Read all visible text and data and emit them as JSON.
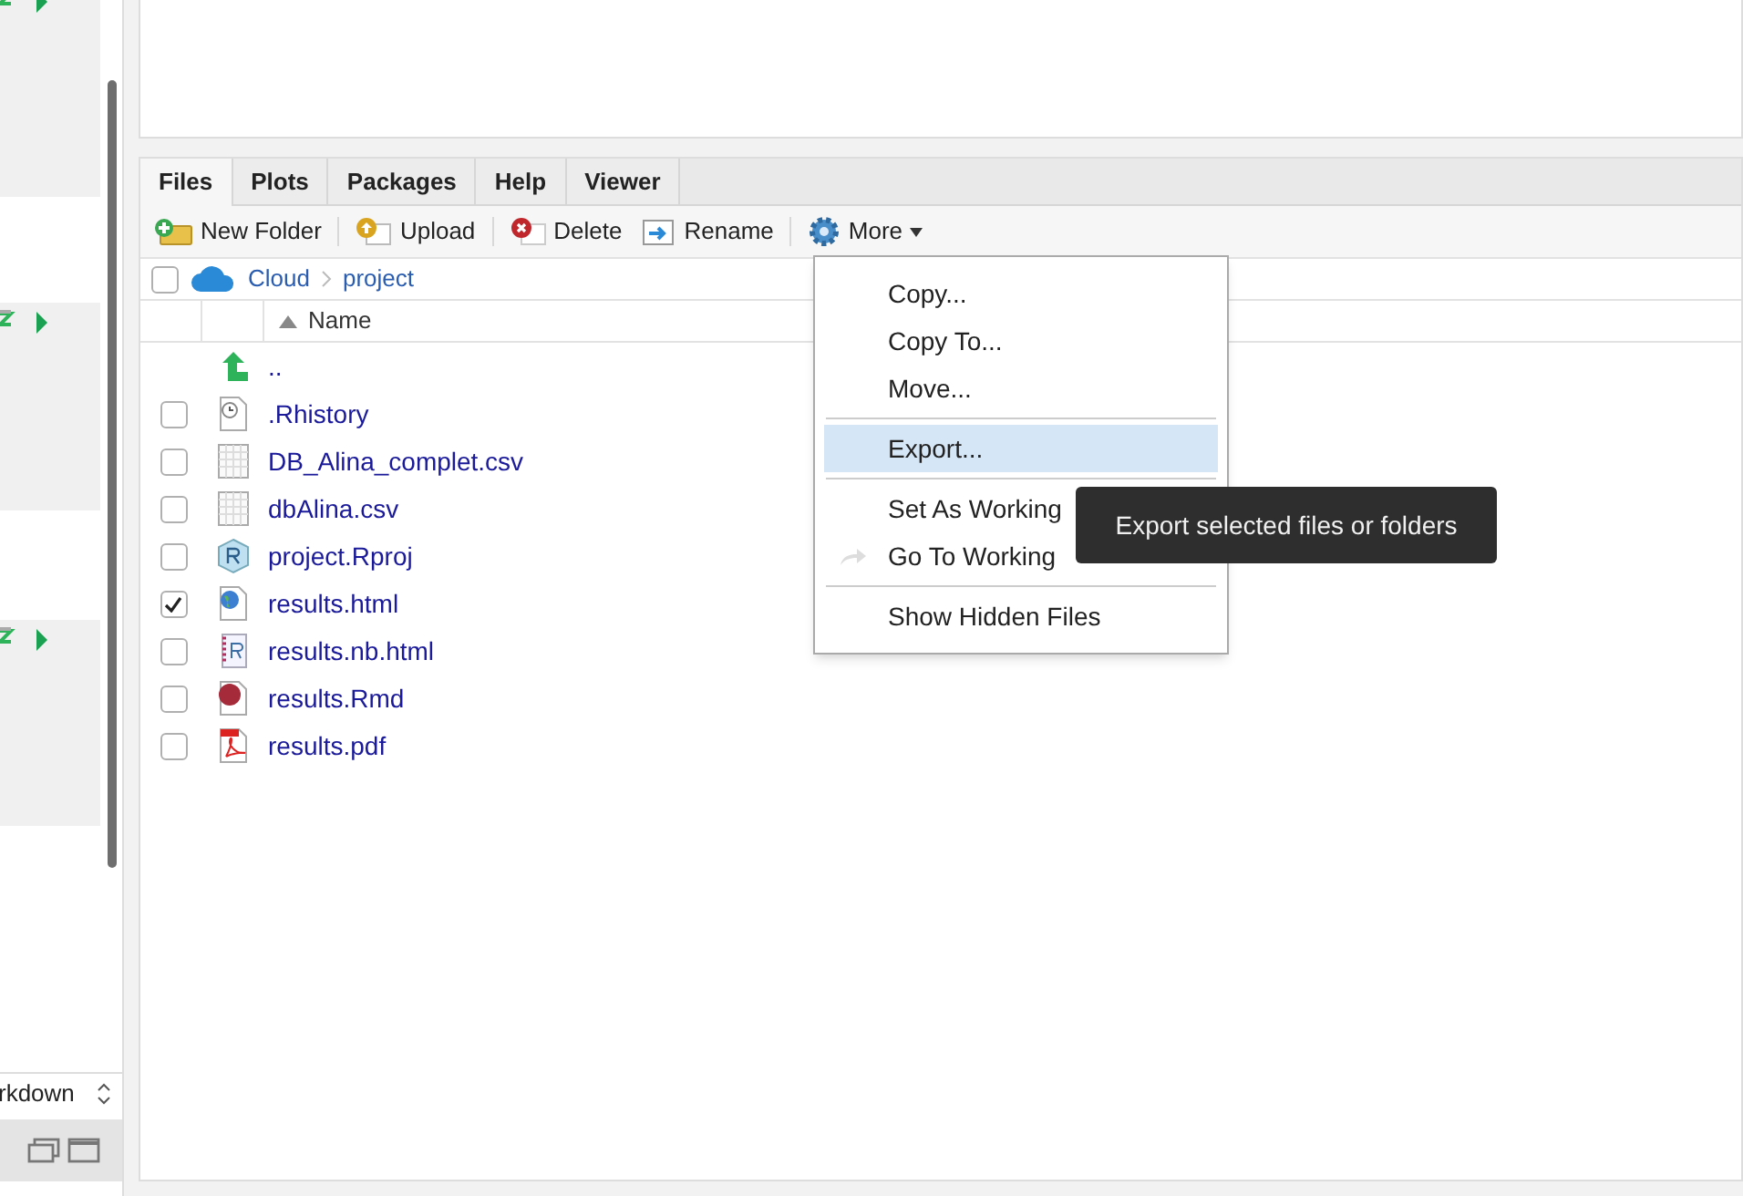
{
  "left_pane": {
    "mode_select": "rkdown"
  },
  "tabs": [
    {
      "label": "Files",
      "selected": true
    },
    {
      "label": "Plots",
      "selected": false
    },
    {
      "label": "Packages",
      "selected": false
    },
    {
      "label": "Help",
      "selected": false
    },
    {
      "label": "Viewer",
      "selected": false
    }
  ],
  "toolbar": [
    {
      "kind": "new-folder",
      "label": "New Folder"
    },
    {
      "kind": "upload",
      "label": "Upload"
    },
    {
      "kind": "delete",
      "label": "Delete"
    },
    {
      "kind": "rename",
      "label": "Rename"
    },
    {
      "kind": "more",
      "label": "More"
    }
  ],
  "select_all": {
    "checked": false
  },
  "breadcrumb": [
    "Cloud",
    "project"
  ],
  "table": {
    "columns": [
      "Name"
    ]
  },
  "files": [
    {
      "kind": "up",
      "name": ".."
    },
    {
      "kind": "history",
      "name": ".Rhistory",
      "checked": false
    },
    {
      "kind": "csv",
      "name": "DB_Alina_complet.csv",
      "checked": false
    },
    {
      "kind": "csv",
      "name": "dbAlina.csv",
      "checked": false
    },
    {
      "kind": "rproj",
      "name": "project.Rproj",
      "checked": false
    },
    {
      "kind": "html",
      "name": "results.html",
      "checked": true
    },
    {
      "kind": "nb",
      "name": "results.nb.html",
      "checked": false
    },
    {
      "kind": "rmd",
      "name": "results.Rmd",
      "checked": false
    },
    {
      "kind": "pdf",
      "name": "results.pdf",
      "checked": false
    }
  ],
  "menu": [
    {
      "kind": "item",
      "label": "Copy...",
      "selected": false
    },
    {
      "kind": "item",
      "label": "Copy To...",
      "selected": false
    },
    {
      "kind": "item",
      "label": "Move...",
      "selected": false
    },
    {
      "kind": "separator"
    },
    {
      "kind": "item",
      "label": "Export...",
      "selected": true
    },
    {
      "kind": "separator"
    },
    {
      "kind": "item",
      "label": "Set As Working",
      "selected": false
    },
    {
      "kind": "arrow-item",
      "label": "Go To Working",
      "selected": false
    },
    {
      "kind": "separator"
    },
    {
      "kind": "item",
      "label": "Show Hidden Files",
      "selected": false
    }
  ],
  "tooltip": "Export selected files or folders"
}
